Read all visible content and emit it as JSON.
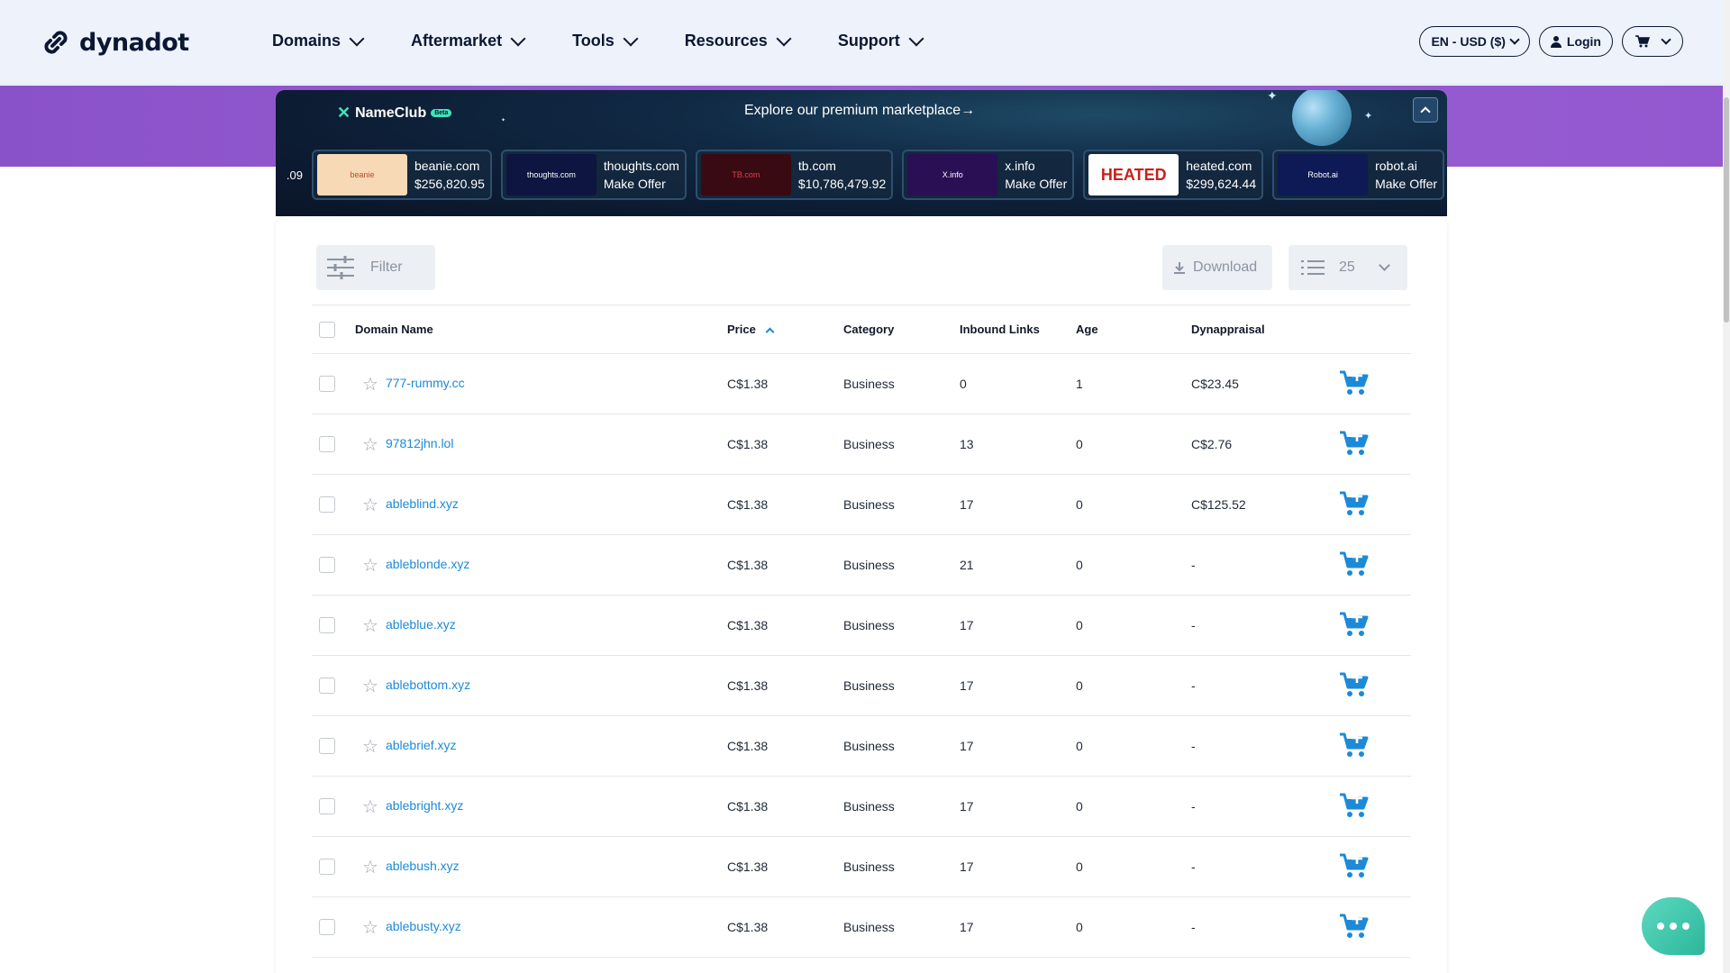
{
  "header": {
    "logo_text": "dynadot",
    "nav": [
      "Domains",
      "Aftermarket",
      "Tools",
      "Resources",
      "Support"
    ],
    "lang_currency": "EN - USD ($)",
    "login_label": "Login"
  },
  "banner": {
    "brand": "NameClub",
    "beta": "Beta",
    "explore": "Explore our premium marketplace→",
    "cut_left_price": ".09",
    "cards": [
      {
        "domain": "beanie.com",
        "price": "$256,820.95",
        "thumb": "beanie",
        "thumb_bg": "#f8d9b5",
        "thumb_fg": "#b44a2d"
      },
      {
        "domain": "thoughts.com",
        "price": "Make Offer",
        "thumb": "thoughts.com",
        "thumb_bg": "#0d1540",
        "thumb_fg": "#ffffff"
      },
      {
        "domain": "tb.com",
        "price": "$10,786,479.92",
        "thumb": "TB.com",
        "thumb_bg": "#3a0a12",
        "thumb_fg": "#e04050"
      },
      {
        "domain": "x.info",
        "price": "Make Offer",
        "thumb": "X.info",
        "thumb_bg": "#2a0f55",
        "thumb_fg": "#ffffff"
      },
      {
        "domain": "heated.com",
        "price": "$299,624.44",
        "thumb": "HEATED",
        "thumb_bg": "#ffffff",
        "thumb_fg": "#c8201c"
      },
      {
        "domain": "robot.ai",
        "price": "Make Offer",
        "thumb": "Robot.ai",
        "thumb_bg": "#0d1a55",
        "thumb_fg": "#ffffff"
      }
    ]
  },
  "toolbar": {
    "filter_label": "Filter",
    "download_label": "Download",
    "per_page": "25"
  },
  "table": {
    "columns": [
      "Domain Name",
      "Price",
      "Category",
      "Inbound Links",
      "Age",
      "Dynappraisal"
    ],
    "rows": [
      {
        "domain": "777-rummy.cc",
        "price": "C$1.38",
        "category": "Business",
        "links": "0",
        "age": "1",
        "appraisal": "C$23.45"
      },
      {
        "domain": "97812jhn.lol",
        "price": "C$1.38",
        "category": "Business",
        "links": "13",
        "age": "0",
        "appraisal": "C$2.76"
      },
      {
        "domain": "ableblind.xyz",
        "price": "C$1.38",
        "category": "Business",
        "links": "17",
        "age": "0",
        "appraisal": "C$125.52"
      },
      {
        "domain": "ableblonde.xyz",
        "price": "C$1.38",
        "category": "Business",
        "links": "21",
        "age": "0",
        "appraisal": "-"
      },
      {
        "domain": "ableblue.xyz",
        "price": "C$1.38",
        "category": "Business",
        "links": "17",
        "age": "0",
        "appraisal": "-"
      },
      {
        "domain": "ablebottom.xyz",
        "price": "C$1.38",
        "category": "Business",
        "links": "17",
        "age": "0",
        "appraisal": "-"
      },
      {
        "domain": "ablebrief.xyz",
        "price": "C$1.38",
        "category": "Business",
        "links": "17",
        "age": "0",
        "appraisal": "-"
      },
      {
        "domain": "ablebright.xyz",
        "price": "C$1.38",
        "category": "Business",
        "links": "17",
        "age": "0",
        "appraisal": "-"
      },
      {
        "domain": "ablebush.xyz",
        "price": "C$1.38",
        "category": "Business",
        "links": "17",
        "age": "0",
        "appraisal": "-"
      },
      {
        "domain": "ablebusty.xyz",
        "price": "C$1.38",
        "category": "Business",
        "links": "17",
        "age": "0",
        "appraisal": "-"
      }
    ]
  },
  "colors": {
    "accent": "#1d8ad8",
    "brand_dark": "#0b1733",
    "band": "#9358cf",
    "chat": "#2bb79b"
  }
}
